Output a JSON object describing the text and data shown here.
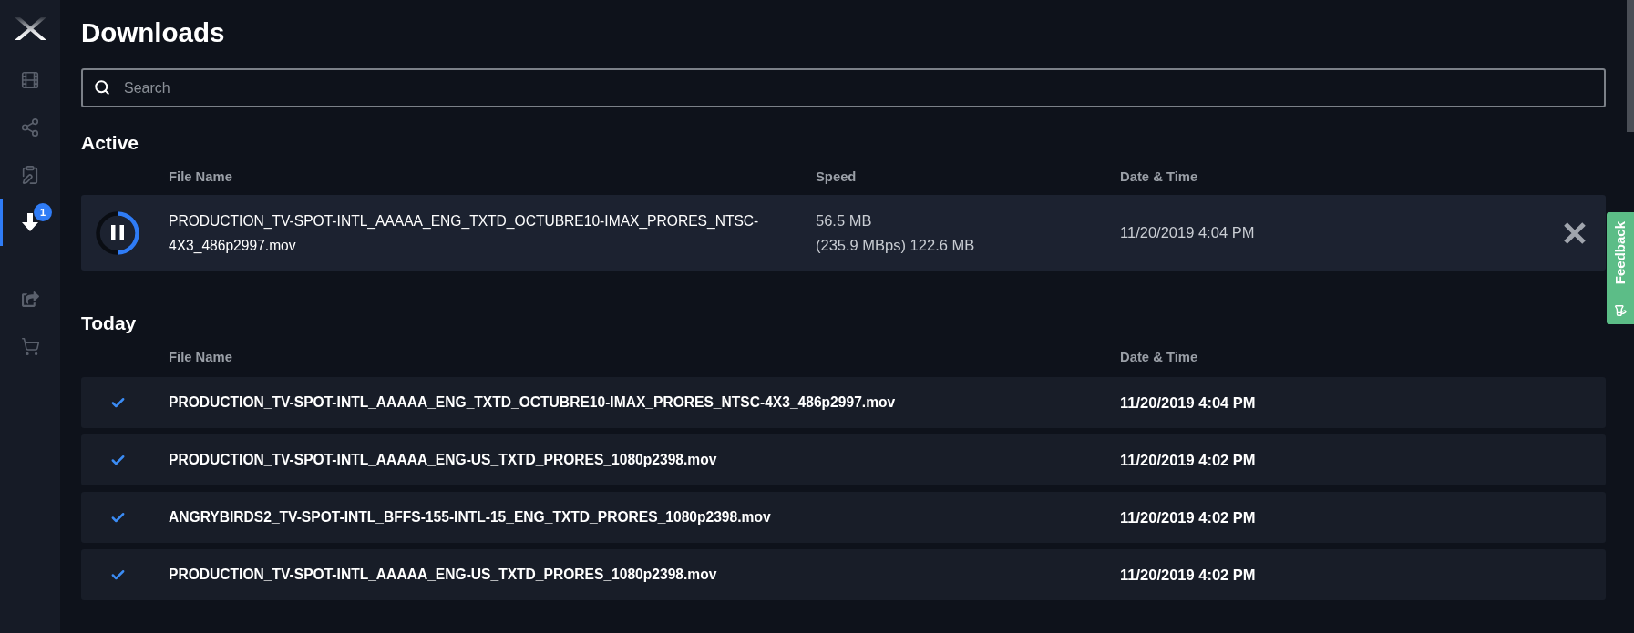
{
  "sidebar": {
    "top_items": [
      {
        "selected": false
      },
      {
        "selected": false
      },
      {
        "selected": false
      },
      {
        "selected": true,
        "badge": "1"
      }
    ],
    "bottom_items": [
      {
        "selected": false
      },
      {
        "selected": false
      }
    ]
  },
  "title": "Downloads",
  "search": {
    "placeholder": "Search"
  },
  "active": {
    "heading": "Active",
    "columns": [
      "File Name",
      "Speed",
      "Date & Time"
    ],
    "rows": [
      {
        "file_name": "PRODUCTION_TV-SPOT-INTL_AAAAA_ENG_TXTD_OCTUBRE10-IMAX_PRORES_NTSC-4X3_486p2997.mov",
        "transferred": "56.5 MB",
        "rate_and_size": "(235.9 MBps) 122.6 MB",
        "date_time": "11/20/2019 4:04 PM",
        "level": 0.5
      }
    ]
  },
  "today": {
    "heading": "Today",
    "columns": [
      "File Name",
      "Date & Time"
    ],
    "rows": [
      {
        "file_name": "PRODUCTION_TV-SPOT-INTL_AAAAA_ENG_TXTD_OCTUBRE10-IMAX_PRORES_NTSC-4X3_486p2997.mov",
        "date_time": "11/20/2019 4:04 PM",
        "completed": true
      },
      {
        "file_name": "PRODUCTION_TV-SPOT-INTL_AAAAA_ENG-US_TXTD_PRORES_1080p2398.mov",
        "date_time": "11/20/2019 4:02 PM",
        "completed": true
      },
      {
        "file_name": "ANGRYBIRDS2_TV-SPOT-INTL_BFFS-155-INTL-15_ENG_TXTD_PRORES_1080p2398.mov",
        "date_time": "11/20/2019 4:02 PM",
        "completed": true
      },
      {
        "file_name": "PRODUCTION_TV-SPOT-INTL_AAAAA_ENG-US_TXTD_PRORES_1080p2398.mov",
        "date_time": "11/20/2019 4:02 PM",
        "completed": true
      }
    ]
  },
  "feedback_tab": {
    "label": "Feedback"
  }
}
